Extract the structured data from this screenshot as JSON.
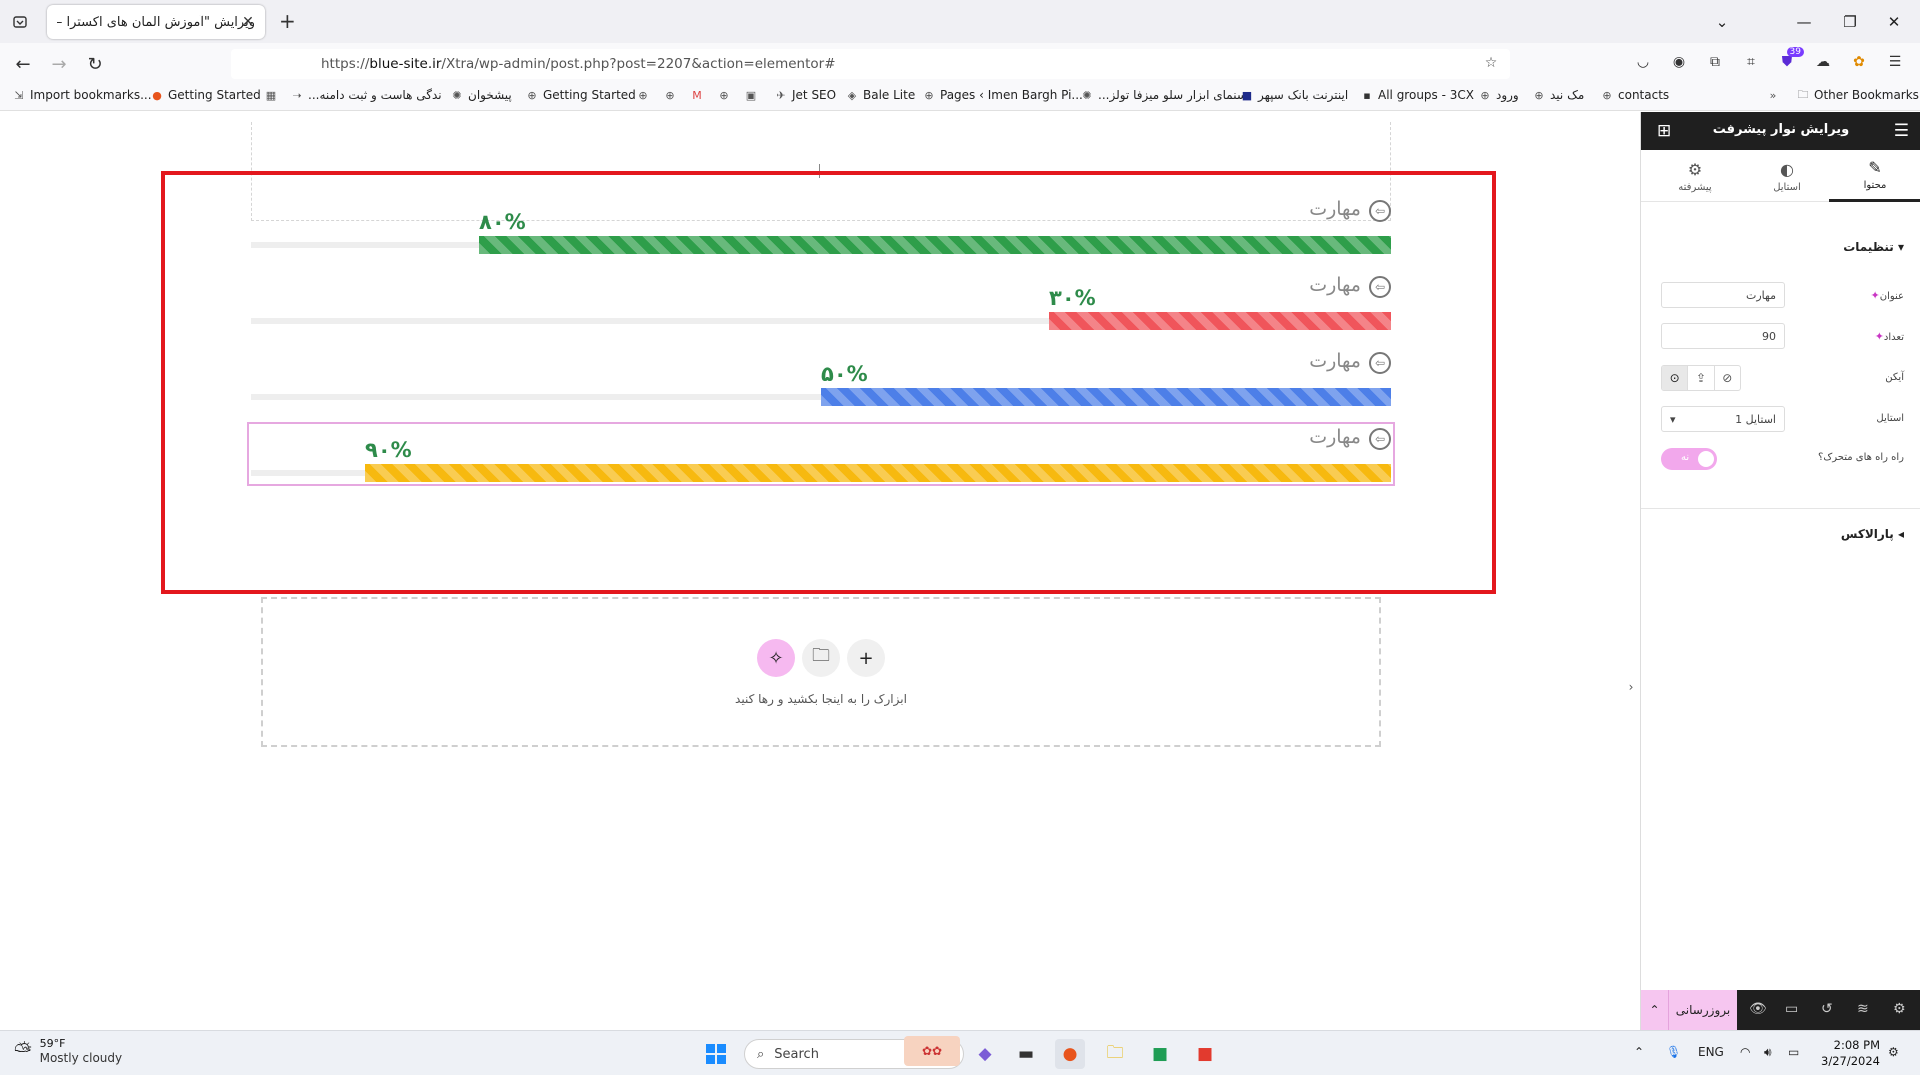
{
  "browser": {
    "tab_title": "ویرایش \"آموزش المان های اکسترا – ...",
    "url_prefix": "https://",
    "url_host": "blue-site.ir",
    "url_path": "/Xtra/wp-admin/post.php?post=2207&action=elementor#",
    "extension_badge": "39"
  },
  "bookmarks": [
    "Import bookmarks...",
    "Getting Started",
    "...ندگی هاست و ثبت دامنه",
    "پیشخوان",
    "Getting Started",
    "Jet SEO",
    "Bale Lite",
    "Pages ‹ Imen Bargh Pi...",
    "...سنمای ابزار سلو میزفا تولز",
    "اینترنت بانک سپهر",
    "All groups - 3CX",
    "ورود",
    "مک نید",
    "contacts",
    "Other Bookmarks"
  ],
  "canvas": {
    "skills": [
      {
        "title": "مهارت",
        "percent_label": "۸۰%",
        "value": 80,
        "color": "#2e9e4a",
        "label_color": "#2e8b4a"
      },
      {
        "title": "مهارت",
        "percent_label": "۳۰%",
        "value": 30,
        "color": "#f0555b",
        "label_color": "#2e8b4a"
      },
      {
        "title": "مهارت",
        "percent_label": "۵۰%",
        "value": 50,
        "color": "#4d7fe8",
        "label_color": "#2e8b4a"
      },
      {
        "title": "مهارت",
        "percent_label": "۹۰%",
        "value": 90,
        "color": "#f7b90f",
        "label_color": "#2e8b4a"
      }
    ],
    "drop_zone_text": "ابزارک را به اینجا بکشید و رها کنید"
  },
  "panel": {
    "title": "ویرایش نوار پیشرفت",
    "tabs": {
      "content": "محتوا",
      "style": "استایل",
      "advanced": "پیشرفته"
    },
    "section_settings": "تنظیمات",
    "controls": {
      "title_label": "عنوان",
      "title_value": "مهارت",
      "count_label": "تعداد",
      "count_value": "90",
      "icon_label": "آیکن",
      "style_label": "استایل",
      "style_value": "استایل 1",
      "striped_label": "راه راه های متحرک؟",
      "striped_value": "نه"
    },
    "section_parallax": "پارالاکس",
    "publish_label": "بروزرسانی"
  },
  "taskbar": {
    "weather_temp": "59°F",
    "weather_cond": "Mostly cloudy",
    "search_placeholder": "Search",
    "lang": "ENG",
    "time": "2:08 PM",
    "date": "3/27/2024"
  }
}
